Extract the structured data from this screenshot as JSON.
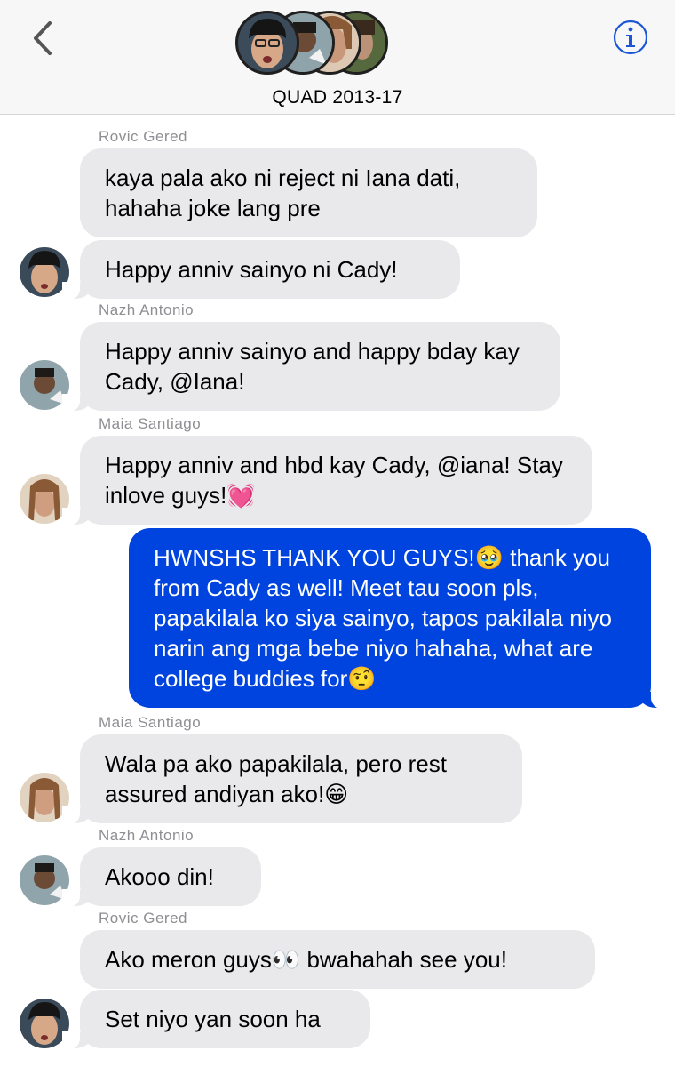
{
  "header": {
    "title": "QUAD 2013-17",
    "back_icon": "chevron-left-icon",
    "info_icon": "info-circle-icon",
    "accent": "#1a56d6"
  },
  "colors": {
    "incoming_bubble": "#e9e9eb",
    "outgoing_bubble": "#0044e0",
    "sender_name": "#8e8e93"
  },
  "messages": [
    {
      "sender": "Rovic Gered",
      "text": "kaya pala ako ni reject ni Iana dati, hahaha joke lang pre"
    },
    {
      "text": "Happy anniv sainyo ni Cady!"
    },
    {
      "sender": "Nazh Antonio",
      "text": "Happy anniv sainyo and happy bday kay Cady, @Iana!"
    },
    {
      "sender": "Maia Santiago",
      "text": "Happy anniv and hbd kay Cady, @iana! Stay inlove guys!💓"
    },
    {
      "text": "HWNSHS THANK YOU GUYS!🥹  thank you from Cady as well! Meet tau soon pls, papakilala ko siya sainyo, tapos pakilala niyo narin ang mga bebe niyo hahaha, what are college buddies for🤨"
    },
    {
      "sender": "Maia Santiago",
      "text": "Wala pa ako papakilala, pero rest assured andiyan ako!😁"
    },
    {
      "sender": "Nazh Antonio",
      "text": "Akooo din!"
    },
    {
      "sender": "Rovic Gered",
      "text": "Ako meron guys👀 bwahahah see you!"
    },
    {
      "text": "Set niyo yan soon ha"
    }
  ]
}
